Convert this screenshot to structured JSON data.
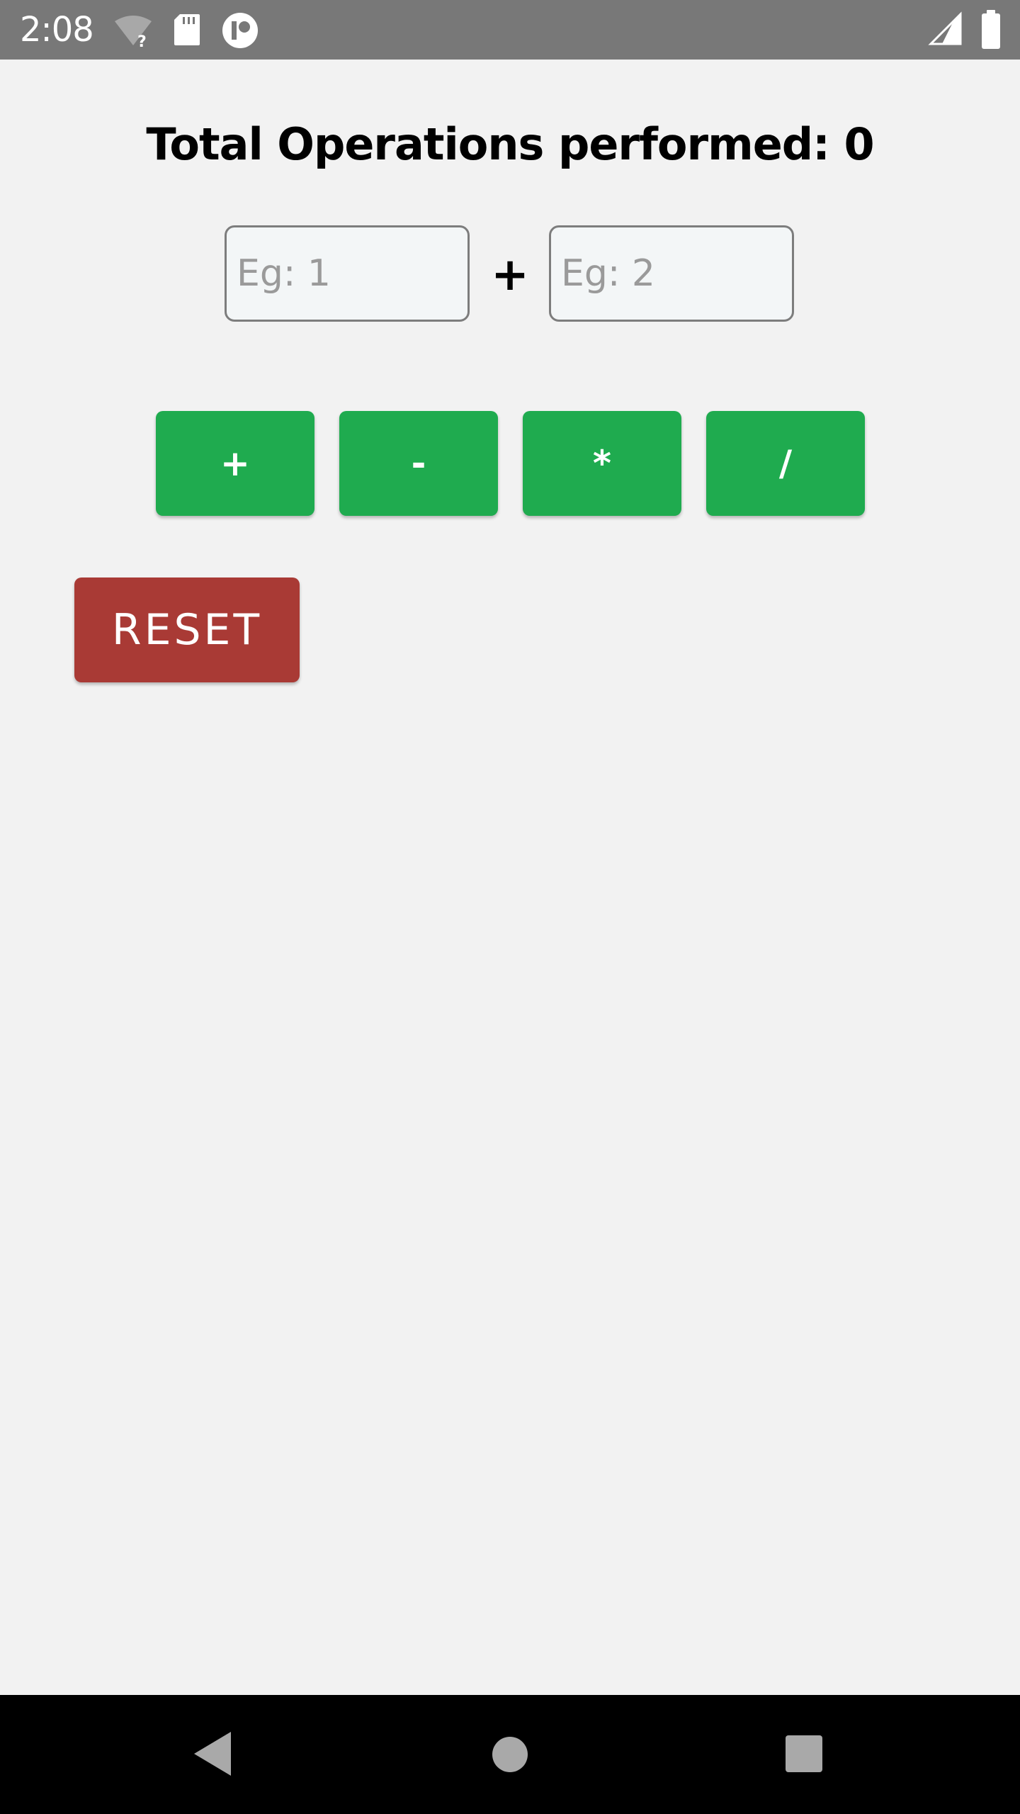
{
  "status_bar": {
    "time": "2:08",
    "icons": [
      "wifi-unknown-icon",
      "sd-card-icon",
      "app-notification-icon",
      "cell-signal-icon",
      "battery-icon"
    ]
  },
  "main": {
    "title": "Total Operations performed: 0",
    "input_a": {
      "placeholder": "Eg: 1",
      "value": ""
    },
    "operator_display": "+",
    "input_b": {
      "placeholder": "Eg: 2",
      "value": ""
    },
    "operations": [
      {
        "label": "+"
      },
      {
        "label": "-"
      },
      {
        "label": "*"
      },
      {
        "label": "/"
      }
    ],
    "reset_label": "RESET"
  },
  "nav_bar": {
    "icons": [
      "back-icon",
      "home-icon",
      "recents-icon"
    ]
  },
  "colors": {
    "status_bar": "#787878",
    "background": "#f2f2f2",
    "operation_button": "#1fab4f",
    "reset_button": "#a93a35",
    "nav_bar": "#000000"
  }
}
